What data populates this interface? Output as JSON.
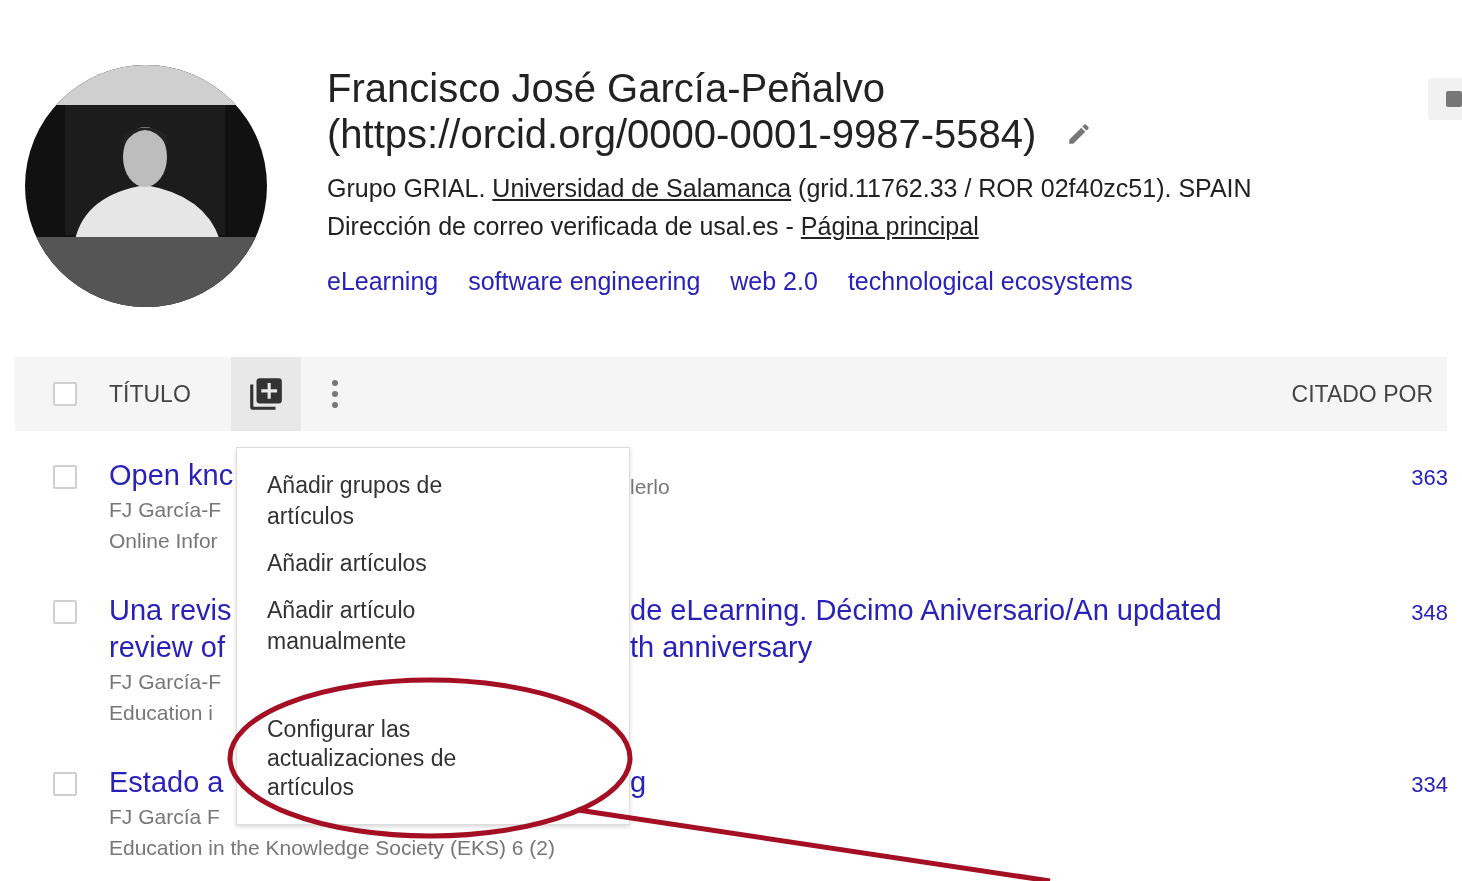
{
  "profile": {
    "name": "Francisco José García-Peñalvo",
    "orcid": "(https://orcid.org/0000-0001-9987-5584)",
    "affiliation": {
      "before": "Grupo GRIAL. ",
      "link": "Universidad de Salamanca",
      "after": " (grid.11762.33 / ROR 02f40zc51). SPAIN"
    },
    "email": {
      "before": "Dirección de correo verificada de usal.es - ",
      "link": "Página principal"
    },
    "interests": [
      "eLearning",
      "software engineering",
      "web 2.0",
      "technological ecosystems"
    ]
  },
  "table": {
    "header": {
      "title": "TÍTULO",
      "cited_by": "CITADO POR",
      "all_checked": false
    },
    "rows": [
      {
        "checked": false,
        "title_left": [
          "Open knc"
        ],
        "title_right": [],
        "authors_left": "FJ García-F",
        "authors_right": "lerlo",
        "venue_left": "Online Infor",
        "citations": "363"
      },
      {
        "checked": false,
        "title_left": [
          "Una revis",
          "review of"
        ],
        "title_right": [
          "de eLearning. Décimo Aniversario/An updated",
          "th anniversary"
        ],
        "authors_left": "FJ García-F",
        "authors_right": "",
        "venue_left": "Education i",
        "citations": "348"
      },
      {
        "checked": false,
        "title_left": [
          "Estado a"
        ],
        "title_right": [
          "g"
        ],
        "authors_left": "FJ García F",
        "authors_right": "",
        "venue_left": "Education in the Knowledge Society (EKS) 6 (2)",
        "citations": "334"
      }
    ]
  },
  "add_menu": {
    "items": [
      {
        "label": "Añadir grupos de artículos",
        "highlighted": false
      },
      {
        "label": "Añadir artículos",
        "highlighted": false
      },
      {
        "label": "Añadir artículo manualmente",
        "highlighted": false
      },
      {
        "label": "Configurar las actualizaciones de artículos",
        "highlighted": true
      }
    ]
  }
}
